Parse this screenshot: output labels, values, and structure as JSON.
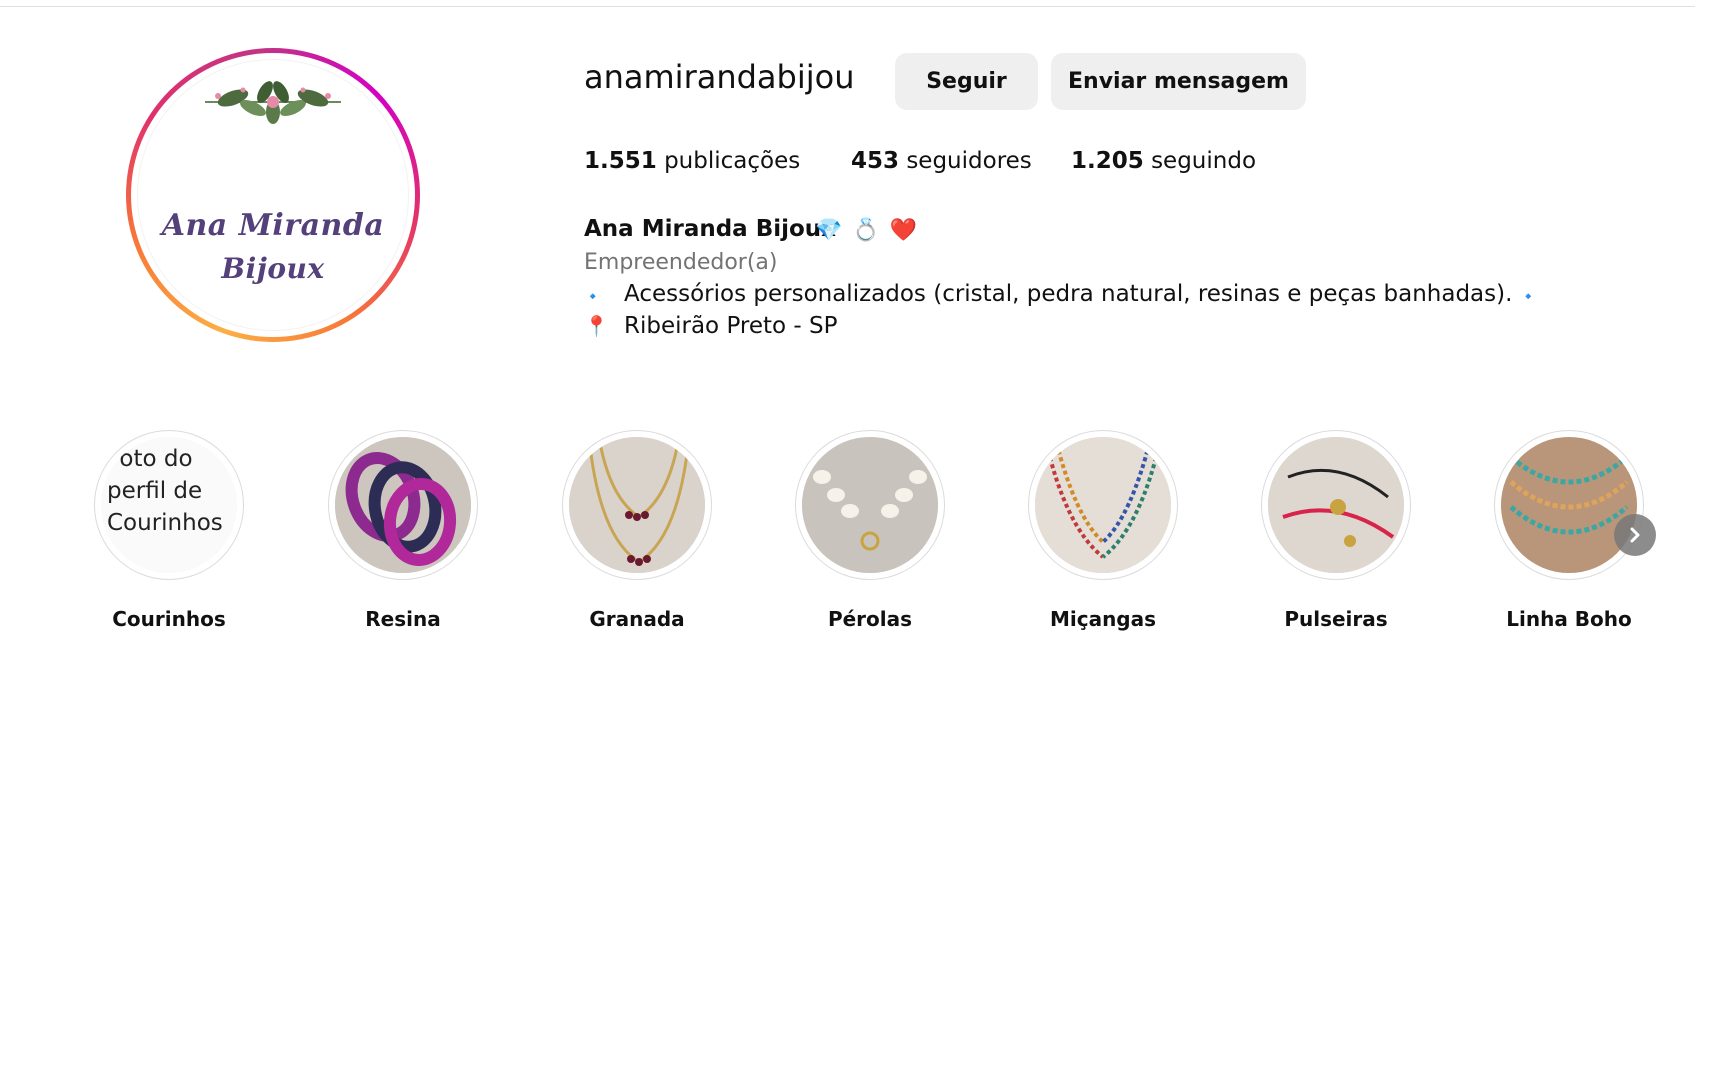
{
  "profile": {
    "username": "anamirandabijou",
    "avatar_text_line1": "Ana Miranda",
    "avatar_text_line2": "Bijoux",
    "follow_label": "Seguir",
    "message_label": "Enviar mensagem",
    "stats": {
      "posts_count": "1.551",
      "posts_label": "publicações",
      "followers_count": "453",
      "followers_label": "seguidores",
      "following_count": "1.205",
      "following_label": "seguindo"
    },
    "full_name": "Ana Miranda Bijoux",
    "name_emojis": [
      "💎",
      "💍",
      "❤️"
    ],
    "category": "Empreendedor(a)",
    "bio_line1": "Acessórios personalizados (cristal, pedra natural, resinas e peças banhadas).",
    "bio_line1_bullet": "🔹",
    "bio_line2": "Ribeirão Preto - SP",
    "bio_line2_icon": "📍"
  },
  "highlights": [
    {
      "label": "Courinhos",
      "alt_text": "Foto do perfil de Courinhos",
      "broken": true
    },
    {
      "label": "Resina"
    },
    {
      "label": "Granada"
    },
    {
      "label": "Pérolas"
    },
    {
      "label": "Miçangas"
    },
    {
      "label": "Pulseiras"
    },
    {
      "label": "Linha Boho"
    }
  ],
  "colors": {
    "button_bg": "#efefef",
    "muted_text": "#737373",
    "avatar_text": "#54407a"
  },
  "icons": {
    "next": "chevron-right-icon"
  }
}
